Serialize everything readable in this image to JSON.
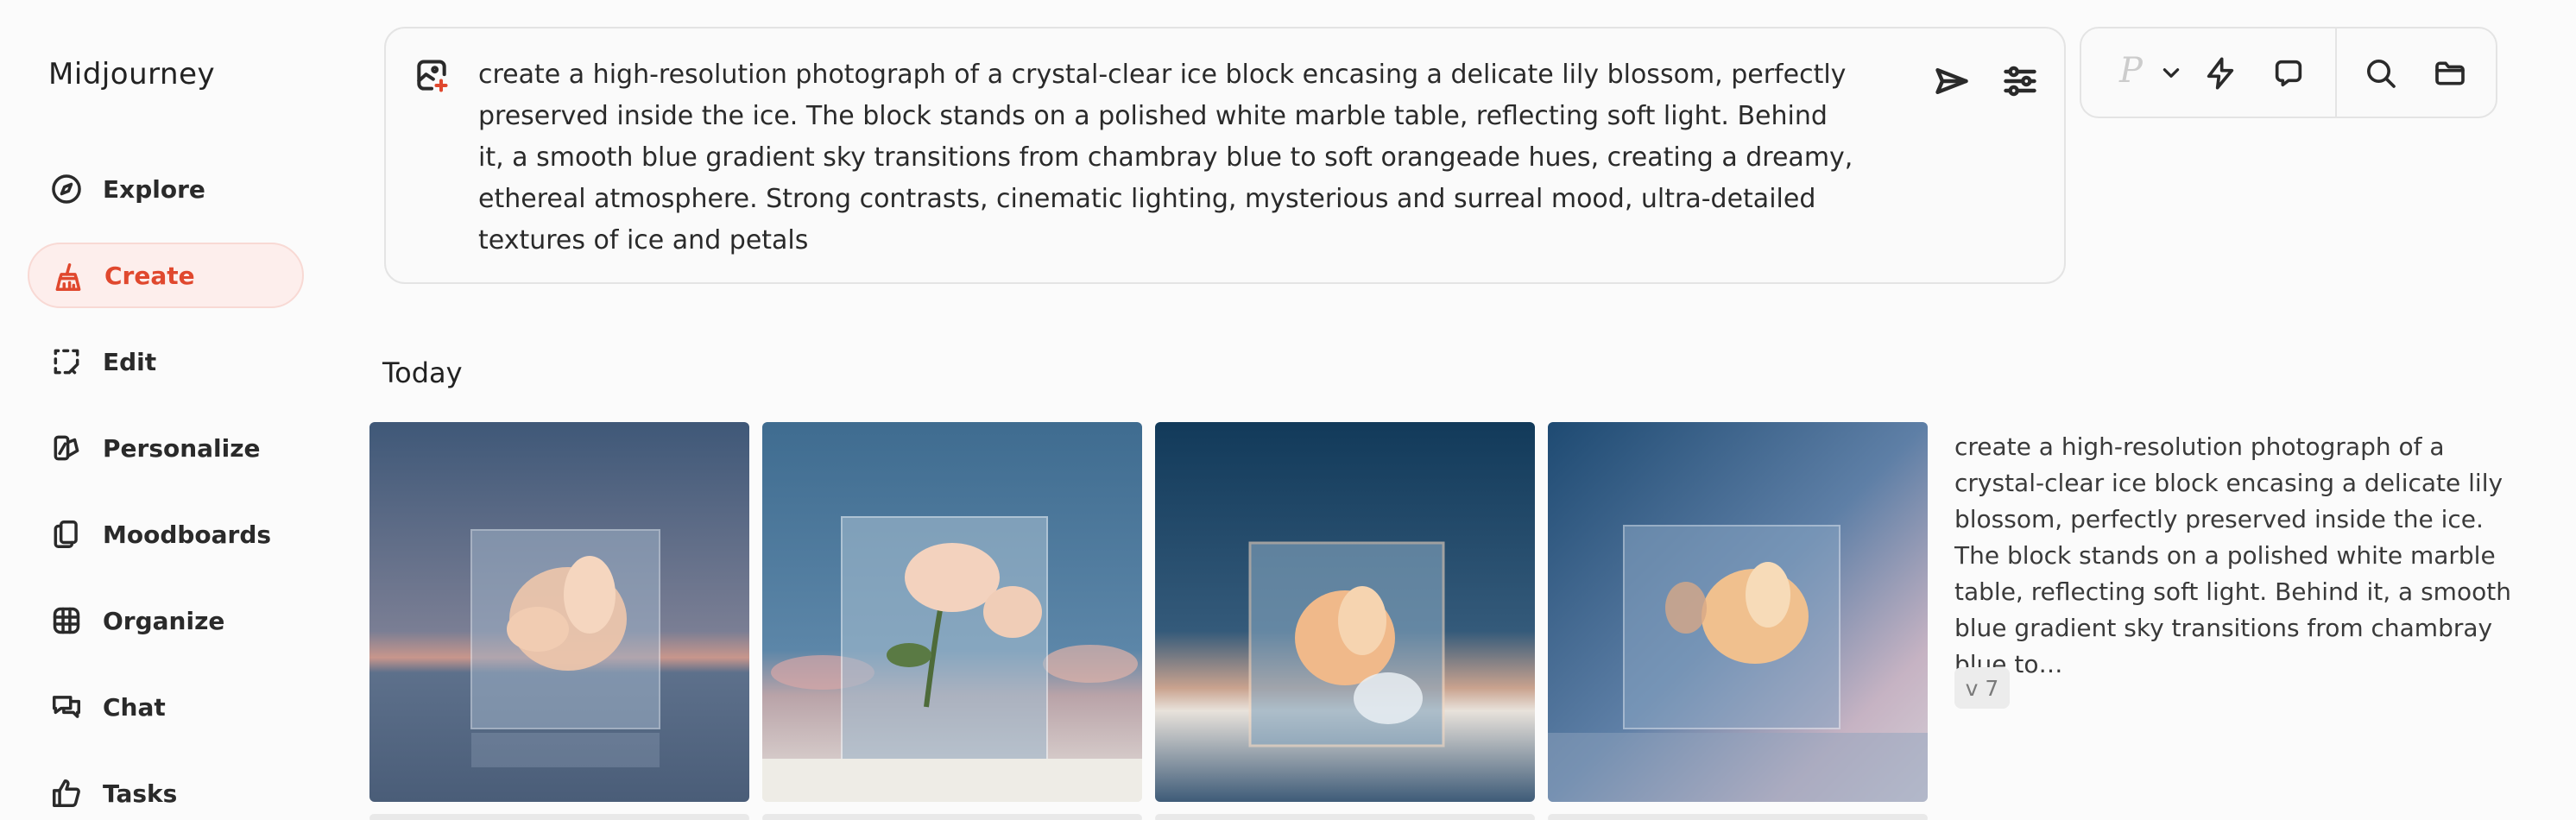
{
  "app": {
    "logo": "Midjourney"
  },
  "sidebar": {
    "items": [
      {
        "label": "Explore",
        "icon": "compass-icon"
      },
      {
        "label": "Create",
        "icon": "brush-icon",
        "active": true
      },
      {
        "label": "Edit",
        "icon": "edit-frame-icon"
      },
      {
        "label": "Personalize",
        "icon": "personalize-icon"
      },
      {
        "label": "Moodboards",
        "icon": "moodboard-icon"
      },
      {
        "label": "Organize",
        "icon": "grid-icon"
      },
      {
        "label": "Chat",
        "icon": "chat-icon"
      },
      {
        "label": "Tasks",
        "icon": "thumbs-up-icon"
      }
    ]
  },
  "prompt": {
    "text": "create a high-resolution photograph of a crystal-clear ice block encasing a delicate lily blossom, perfectly preserved inside the ice. The block stands on a polished white marble table, reflecting soft light. Behind it, a smooth blue gradient sky transitions from chambray blue to soft orangeade hues, creating a dreamy, ethereal atmosphere. Strong contrasts, cinematic lighting, mysterious and surreal mood, ultra-detailed textures of ice and petals"
  },
  "toolbar": {
    "personalize_letter": "P"
  },
  "feed": {
    "heading": "Today",
    "job": {
      "description": "create a high-resolution photograph of a crystal-clear ice block encasing a delicate lily blossom, perfectly preserved inside the ice. The block stands on a polished white marble table, reflecting soft light. Behind it, a smooth blue gradient sky transitions from chambray blue to…",
      "version": "v 7"
    }
  },
  "colors": {
    "accent": "#e0482e",
    "accent_bg": "#fdeeec",
    "background": "#fbfbfb"
  }
}
